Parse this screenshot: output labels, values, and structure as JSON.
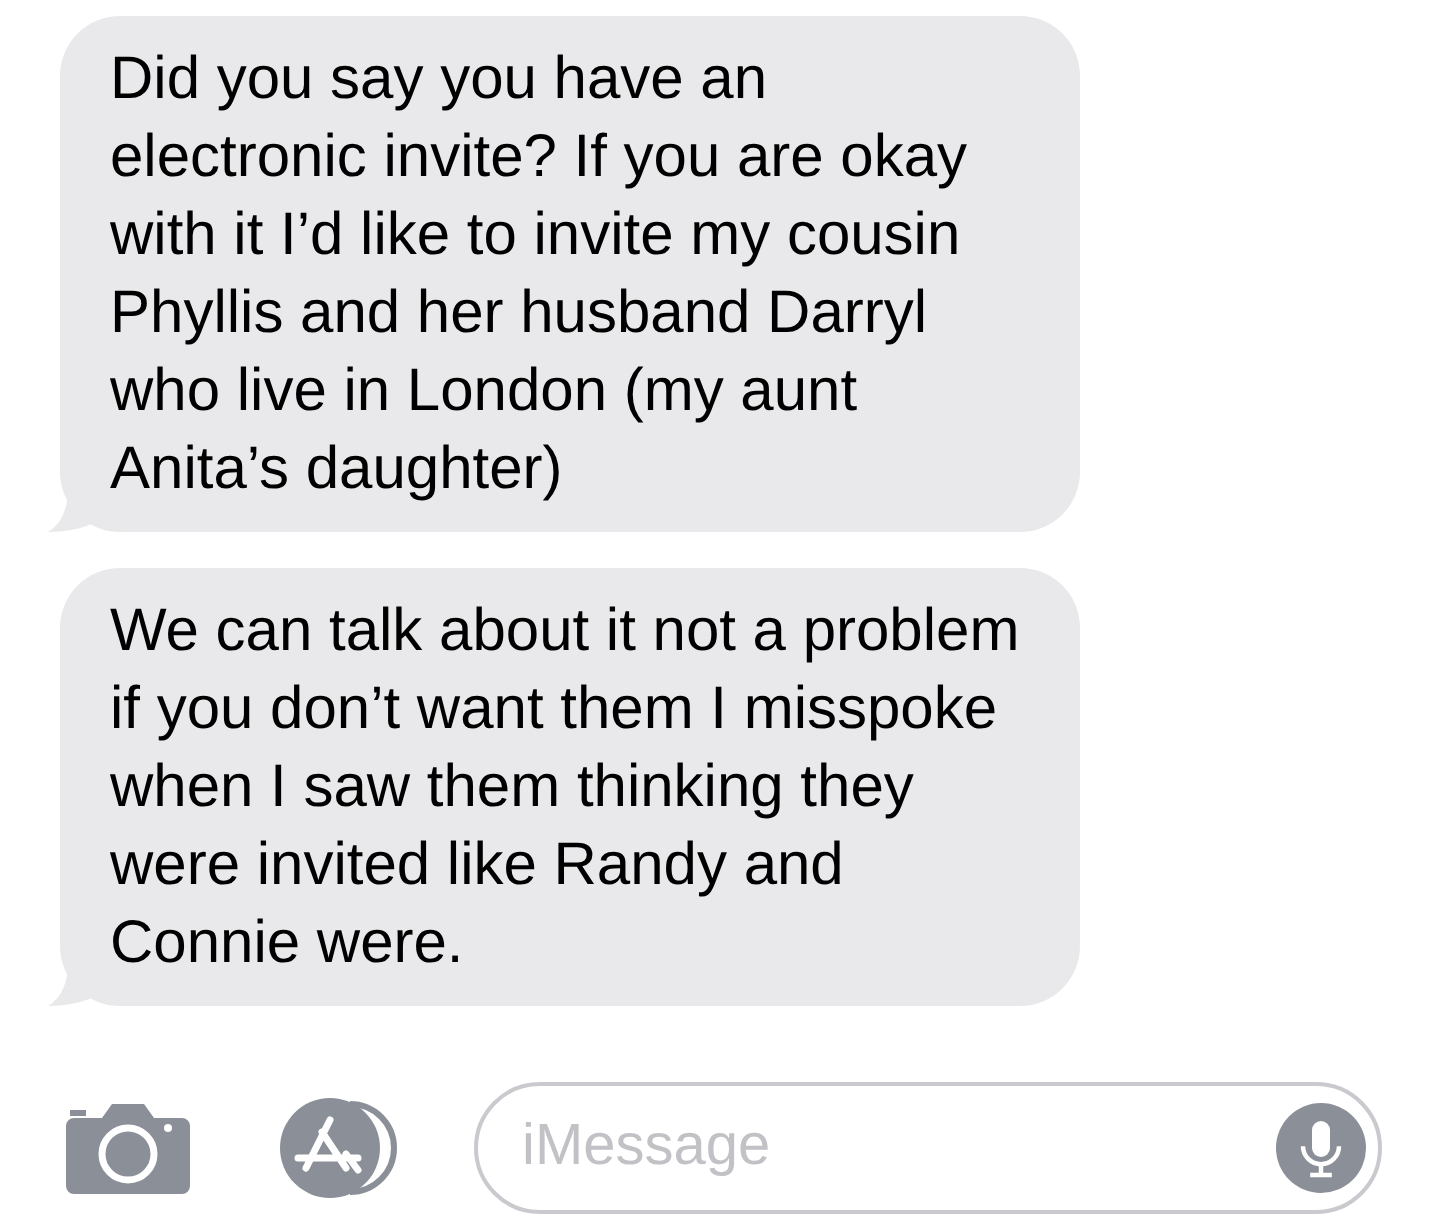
{
  "messages": [
    {
      "text": "Did you say you have an electronic invite? If you are okay with it I’d like to invite my cousin Phyllis and her husband Darryl who live in London (my aunt Anita’s daughter)"
    },
    {
      "text": "We can talk about it not a problem if you don’t want them I misspoke when I saw them thinking they were invited like Randy and Connie were."
    }
  ],
  "composer": {
    "placeholder": "iMessage"
  }
}
